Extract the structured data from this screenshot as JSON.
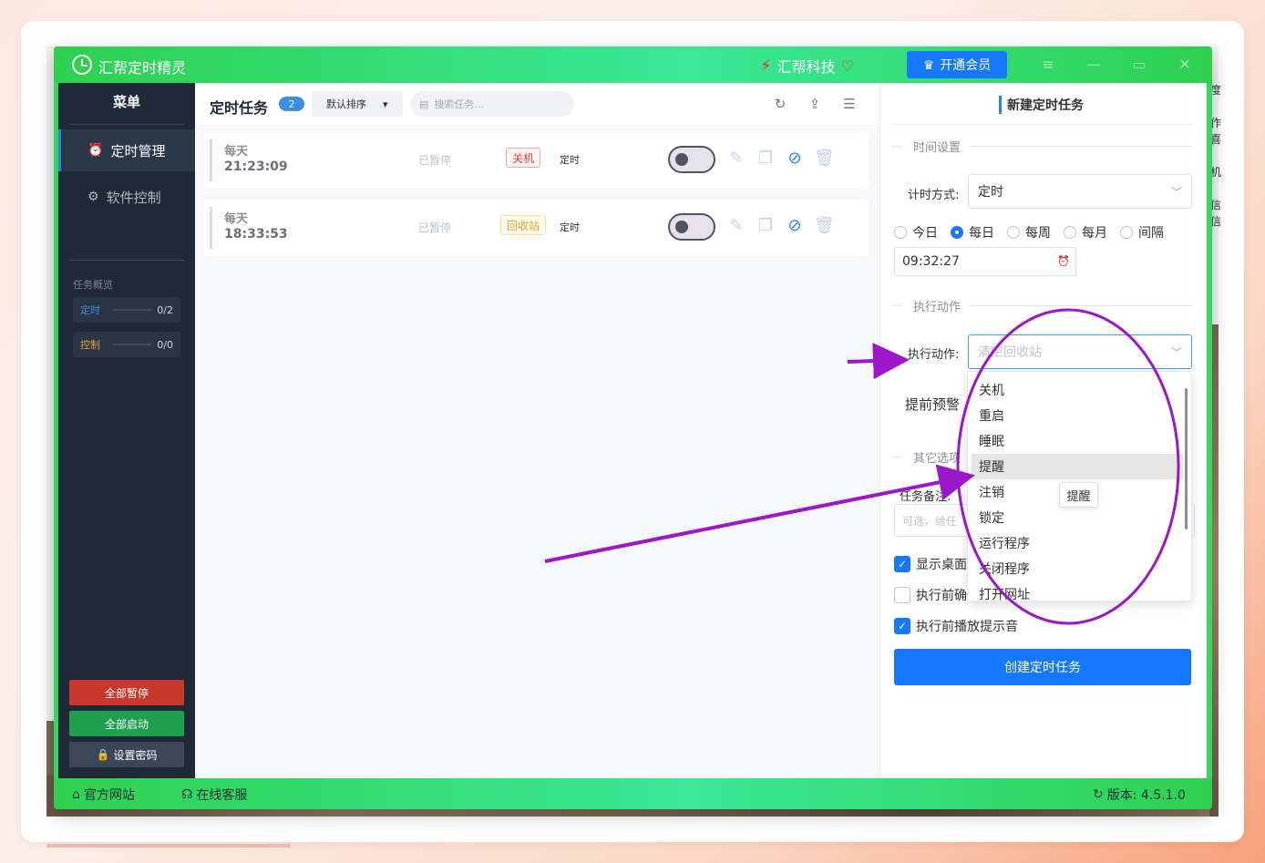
{
  "window": {
    "title": "汇帮定时精灵",
    "brand": "汇帮科技",
    "vip_button": "开通会员"
  },
  "background": {
    "right_edge_chars": [
      "度",
      "作",
      "喜",
      "机",
      "信",
      "信"
    ]
  },
  "sidebar": {
    "menu_title": "菜单",
    "items": [
      {
        "label": "定时管理",
        "icon": "alarm-clock-icon",
        "active": true
      },
      {
        "label": "软件控制",
        "icon": "gear-icon",
        "active": false
      }
    ],
    "overview_title": "任务概览",
    "stats": [
      {
        "label": "定时",
        "count": "0/2",
        "color": "#3a8ee6"
      },
      {
        "label": "控制",
        "count": "0/0",
        "color": "#e6a23c"
      }
    ],
    "buttons": {
      "pause_all": "全部暂停",
      "start_all": "全部启动",
      "set_password": "设置密码"
    }
  },
  "main": {
    "title": "定时任务",
    "count": "2",
    "sort_label": "默认排序",
    "search_placeholder": "搜索任务...",
    "tasks": [
      {
        "freq": "每天",
        "time": "21:23:09",
        "status": "已暂停",
        "action": "关机",
        "action_color": "red",
        "type": "定时",
        "enabled": false
      },
      {
        "freq": "每天",
        "time": "18:33:53",
        "status": "已暂停",
        "action": "回收站",
        "action_color": "yellow",
        "type": "定时",
        "enabled": false
      }
    ]
  },
  "form": {
    "title": "新建定时任务",
    "section_time": "时间设置",
    "timing_mode_label": "计时方式:",
    "timing_mode_value": "定时",
    "radios": [
      {
        "label": "今日",
        "checked": false
      },
      {
        "label": "每日",
        "checked": true
      },
      {
        "label": "每周",
        "checked": false
      },
      {
        "label": "每月",
        "checked": false
      },
      {
        "label": "间隔",
        "checked": false
      }
    ],
    "time_value": "09:32:27",
    "section_action": "执行动作",
    "action_label": "执行动作:",
    "action_placeholder": "清空回收站",
    "advance_warning_label": "提前预警",
    "section_other": "其它选项",
    "remark_label": "任务备注:",
    "remark_placeholder": "可选，给任",
    "checks": [
      {
        "label": "显示桌面",
        "checked": true
      },
      {
        "label": "执行前确",
        "checked": false
      },
      {
        "label": "执行前播放提示音",
        "checked": true
      }
    ],
    "create_button": "创建定时任务"
  },
  "dropdown": {
    "options": [
      "关机",
      "重启",
      "睡眠",
      "提醒",
      "注销",
      "锁定",
      "运行程序",
      "关闭程序",
      "打开网址"
    ],
    "hovered_index": 3,
    "tooltip": "提醒"
  },
  "statusbar": {
    "website": "官方网站",
    "support": "在线客服",
    "version": "版本:  4.5.1.0"
  },
  "colors": {
    "titlebar_green": "#2dd14f",
    "sidebar_bg": "#1f2a38",
    "primary_blue": "#1677ff",
    "annotation_purple": "#9b17c9"
  }
}
